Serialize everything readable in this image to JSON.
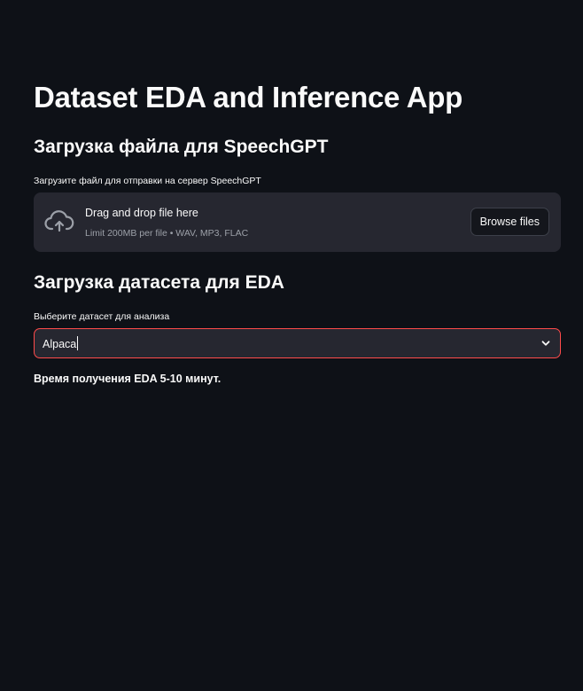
{
  "page": {
    "title": "Dataset EDA and Inference App"
  },
  "upload": {
    "header": "Загрузка файла для SpeechGPT",
    "label": "Загрузите файл для отправки на сервер SpeechGPT",
    "dropzone_title": "Drag and drop file here",
    "dropzone_limit": "Limit 200MB per file • WAV, MP3, FLAC",
    "browse_label": "Browse files",
    "icon": "cloud-upload-icon"
  },
  "dataset": {
    "header": "Загрузка датасета для EDA",
    "label": "Выберите датасет для анализа",
    "selected_value": "Alpaca",
    "dropdown_icon": "chevron-down-icon",
    "info": "Время получения EDA 5-10 минут."
  },
  "colors": {
    "background": "#0e1117",
    "widget_background": "#262730",
    "focus_border": "#ff4b4b",
    "text": "#fafafa"
  }
}
